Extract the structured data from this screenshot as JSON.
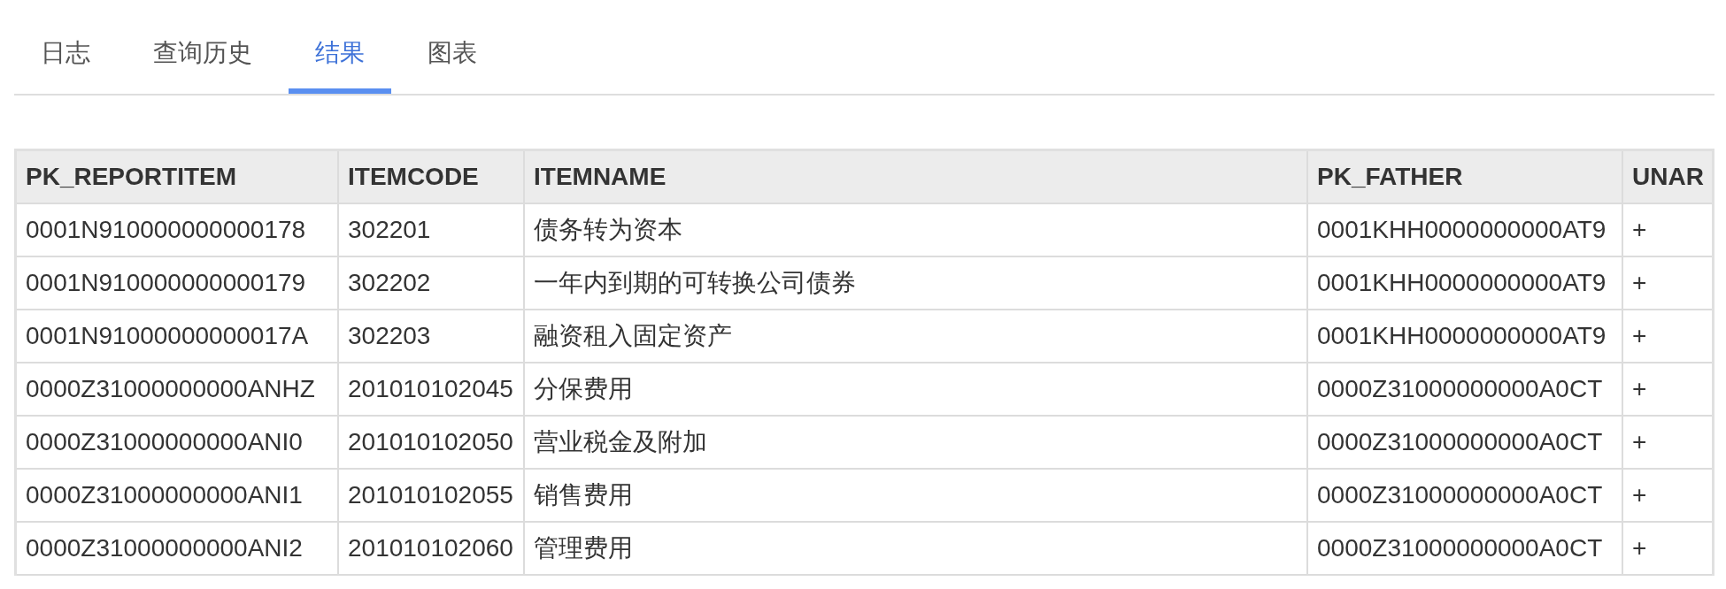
{
  "tabs": [
    {
      "label": "日志",
      "selected": false
    },
    {
      "label": "查询历史",
      "selected": false
    },
    {
      "label": "结果",
      "selected": true
    },
    {
      "label": "图表",
      "selected": false
    }
  ],
  "table": {
    "columns": [
      "PK_REPORTITEM",
      "ITEMCODE",
      "ITEMNAME",
      "PK_FATHER",
      "UNAR"
    ],
    "rows": [
      [
        "0001N910000000000178",
        "302201",
        "债务转为资本",
        "0001KHH0000000000AT9",
        "+"
      ],
      [
        "0001N910000000000179",
        "302202",
        "一年内到期的可转换公司债券",
        "0001KHH0000000000AT9",
        "+"
      ],
      [
        "0001N91000000000017A",
        "302203",
        "融资租入固定资产",
        "0001KHH0000000000AT9",
        "+"
      ],
      [
        "0000Z31000000000ANHZ",
        "201010102045",
        "分保费用",
        "0000Z31000000000A0CT",
        "+"
      ],
      [
        "0000Z31000000000ANI0",
        "201010102050",
        "营业税金及附加",
        "0000Z31000000000A0CT",
        "+"
      ],
      [
        "0000Z31000000000ANI1",
        "201010102055",
        "销售费用",
        "0000Z31000000000A0CT",
        "+"
      ],
      [
        "0000Z31000000000ANI2",
        "201010102060",
        "管理费用",
        "0000Z31000000000A0CT",
        "+"
      ]
    ]
  }
}
